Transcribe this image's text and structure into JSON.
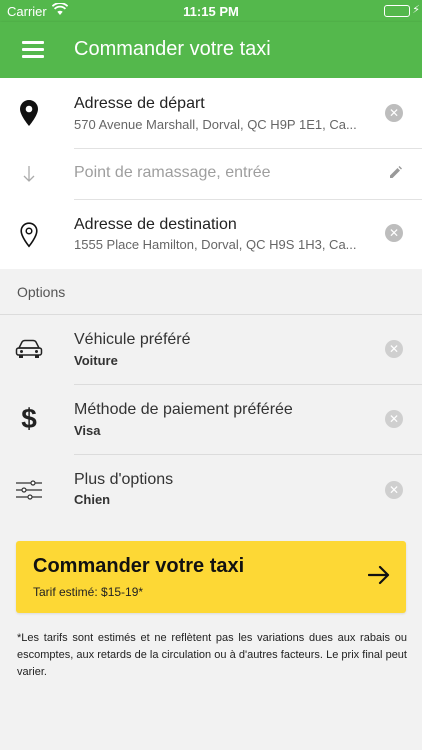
{
  "status": {
    "carrier": "Carrier",
    "time": "11:15 PM"
  },
  "header": {
    "title": "Commander votre taxi"
  },
  "addresses": {
    "departure": {
      "label": "Adresse de départ",
      "value": "570 Avenue Marshall, Dorval, QC H9P 1E1, Ca..."
    },
    "pickup": {
      "placeholder": "Point de ramassage, entrée"
    },
    "destination": {
      "label": "Adresse de destination",
      "value": "1555 Place Hamilton, Dorval, QC H9S 1H3, Ca..."
    }
  },
  "options": {
    "section_label": "Options",
    "items": [
      {
        "label": "Véhicule préféré",
        "value": "Voiture",
        "icon": "car-icon"
      },
      {
        "label": "Méthode de paiement préférée",
        "value": "Visa",
        "icon": "dollar-icon"
      },
      {
        "label": "Plus d'options",
        "value": "Chien",
        "icon": "sliders-icon"
      }
    ]
  },
  "cta": {
    "title": "Commander votre taxi",
    "fare": "Tarif estimé: $15-19*"
  },
  "disclaimer": "*Les tarifs sont estimés et ne reflètent pas les variations dues aux rabais ou escomptes, aux retards de la circulation ou à d'autres facteurs. Le prix final peut varier.",
  "colors": {
    "header": "#54b84c",
    "cta": "#fdd835",
    "background": "#f2f2f2"
  }
}
